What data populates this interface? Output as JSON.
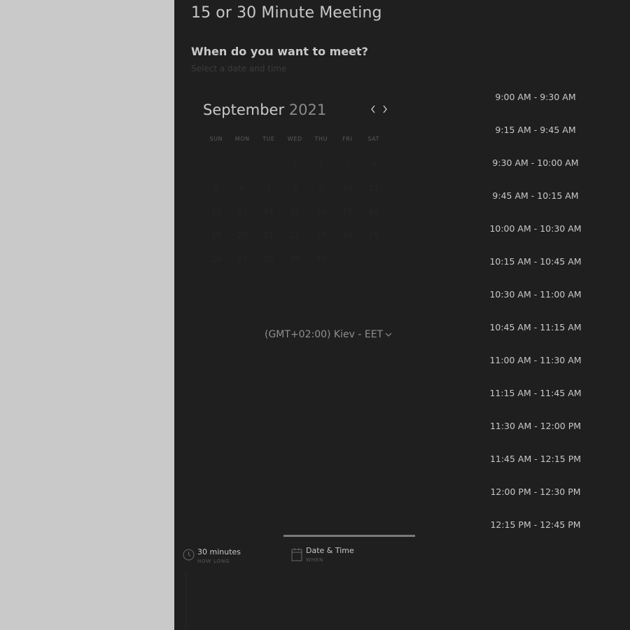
{
  "header": {
    "title": "15 or 30 Minute Meeting",
    "subtitle": "When do you want to meet?",
    "hint": "Select a date and time"
  },
  "calendar": {
    "month": "September",
    "year": "2021",
    "prev_icon": "chevron-left-icon",
    "next_icon": "chevron-right-icon",
    "weekdays": [
      "SUN",
      "MON",
      "TUE",
      "WED",
      "THU",
      "FRI",
      "SAT"
    ],
    "days": [
      "",
      "",
      "",
      "1",
      "2",
      "3",
      "4",
      "5",
      "6",
      "7",
      "8",
      "9",
      "10",
      "11",
      "12",
      "13",
      "14",
      "15",
      "16",
      "17",
      "18",
      "19",
      "20",
      "21",
      "22",
      "23",
      "24",
      "25",
      "26",
      "27",
      "28",
      "29",
      "30",
      "",
      ""
    ]
  },
  "timezone": {
    "label": "(GMT+02:00) Kiev - EET",
    "icon": "chevron-down-icon"
  },
  "time_slots": [
    "9:00 AM - 9:30 AM",
    "9:15 AM - 9:45 AM",
    "9:30 AM - 10:00 AM",
    "9:45 AM - 10:15 AM",
    "10:00 AM - 10:30 AM",
    "10:15 AM - 10:45 AM",
    "10:30 AM - 11:00 AM",
    "10:45 AM - 11:15 AM",
    "11:00 AM - 11:30 AM",
    "11:15 AM - 11:45 AM",
    "11:30 AM - 12:00 PM",
    "11:45 AM - 12:15 PM",
    "12:00 PM - 12:30 PM",
    "12:15 PM - 12:45 PM"
  ],
  "steps": {
    "duration": {
      "main": "30 minutes",
      "sub": "HOW LONG",
      "icon": "clock-icon"
    },
    "datetime": {
      "main": "Date & Time",
      "sub": "WHEN",
      "icon": "calendar-icon"
    }
  },
  "colors": {
    "panel_bg": "#1f1f1f",
    "page_bg": "#c9c9c9",
    "text": "#c9c9c9"
  }
}
